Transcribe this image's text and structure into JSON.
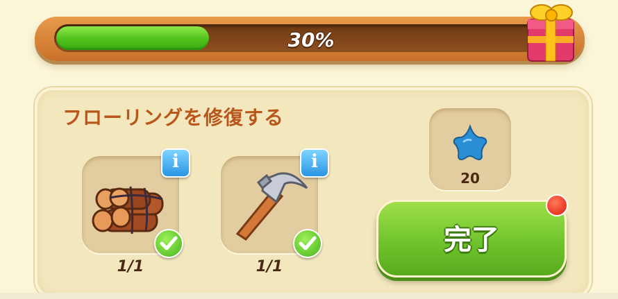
{
  "progress": {
    "label": "30%",
    "value": 0.3
  },
  "task": {
    "title": "フローリングを修復する",
    "requirements": [
      {
        "item": "wood-logs",
        "count": "1/1",
        "completed": true
      },
      {
        "item": "hammer",
        "count": "1/1",
        "completed": true
      }
    ],
    "reward": {
      "item": "blue-star",
      "amount": "20"
    },
    "complete_label": "完了"
  },
  "icons": {
    "gift": "gift-icon",
    "info": "info-icon",
    "check": "checkmark-icon",
    "reward": "star-icon"
  },
  "colors": {
    "progress_fill": "#4fc21c",
    "title": "#b9561c",
    "complete_button": "#6cc12a",
    "notification": "#e01a10"
  }
}
